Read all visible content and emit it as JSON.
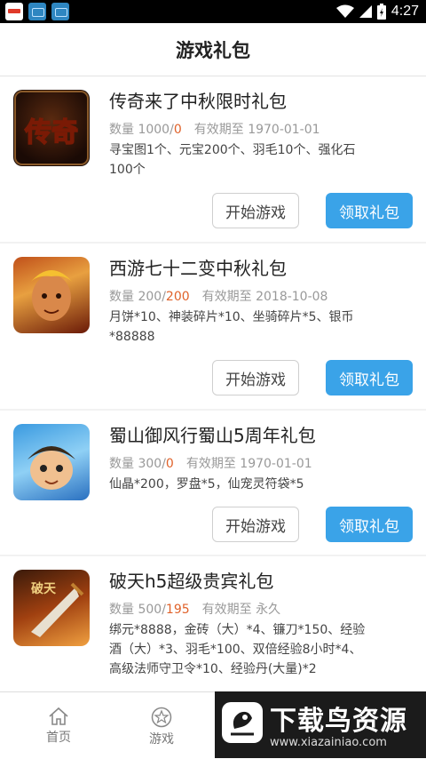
{
  "status_bar": {
    "time": "4:27"
  },
  "header": {
    "title": "游戏礼包"
  },
  "packs": [
    {
      "title": "传奇来了中秋限时礼包",
      "count_label": "数量",
      "total": "1000",
      "remaining": "0",
      "expiry_label": "有效期至",
      "expiry": "1970-01-01",
      "content_lines": [
        "寻宝图1个、元宝200个、羽毛10个、强化石",
        "100个"
      ],
      "play_label": "开始游戏",
      "claim_label": "领取礼包",
      "icon_text": "传奇"
    },
    {
      "title": "西游七十二变中秋礼包",
      "count_label": "数量",
      "total": "200",
      "remaining": "200",
      "expiry_label": "有效期至",
      "expiry": "2018-10-08",
      "content_lines": [
        "月饼*10、神装碎片*10、坐骑碎片*5、银币",
        "*88888"
      ],
      "play_label": "开始游戏",
      "claim_label": "领取礼包"
    },
    {
      "title": "蜀山御风行蜀山5周年礼包",
      "count_label": "数量",
      "total": "300",
      "remaining": "0",
      "expiry_label": "有效期至",
      "expiry": "1970-01-01",
      "content_lines": [
        "仙晶*200，罗盘*5，仙宠灵符袋*5"
      ],
      "play_label": "开始游戏",
      "claim_label": "领取礼包"
    },
    {
      "title": "破天h5超级贵宾礼包",
      "count_label": "数量",
      "total": "500",
      "remaining": "195",
      "expiry_label": "有效期至",
      "expiry": "永久",
      "content_lines": [
        "绑元*8888，金砖（大）*4、镰刀*150、经验",
        "酒（大）*3、羽毛*100、双倍经验8小时*4、",
        "高级法师守卫令*10、经验丹(大量)*2"
      ],
      "icon_text": "破天"
    }
  ],
  "tabbar": {
    "tabs": [
      {
        "label": "首页",
        "icon": "home-icon"
      },
      {
        "label": "游戏",
        "icon": "star-icon"
      }
    ]
  },
  "watermark": {
    "text": "下载鸟资源",
    "url": "www.xiazainiao.com"
  }
}
